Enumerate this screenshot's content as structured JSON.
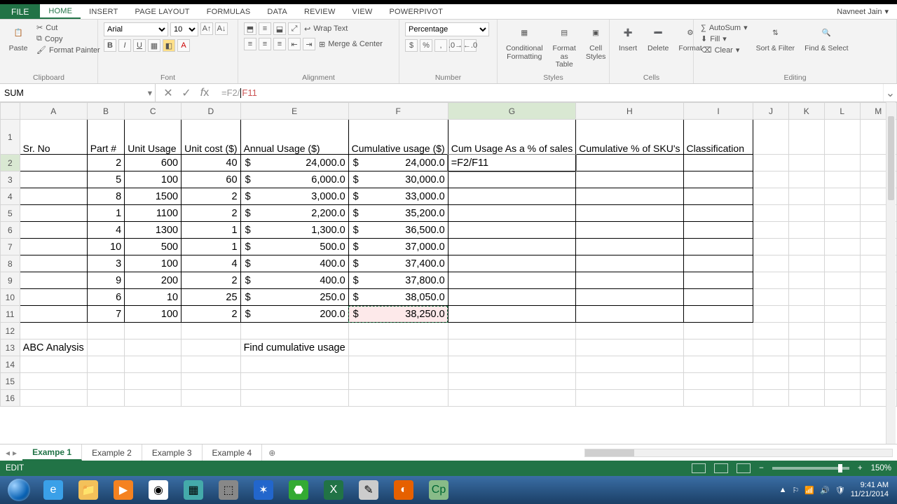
{
  "user": "Navneet Jain",
  "tabs": {
    "file": "FILE",
    "home": "HOME",
    "insert": "INSERT",
    "pageLayout": "PAGE LAYOUT",
    "formulas": "FORMULAS",
    "data": "DATA",
    "review": "REVIEW",
    "view": "VIEW",
    "powerpivot": "POWERPIVOT"
  },
  "ribbon": {
    "clipboard": {
      "paste": "Paste",
      "cut": "Cut",
      "copy": "Copy",
      "formatPainter": "Format Painter",
      "label": "Clipboard"
    },
    "font": {
      "name": "Arial",
      "size": "10",
      "label": "Font"
    },
    "alignment": {
      "wrap": "Wrap Text",
      "merge": "Merge & Center",
      "label": "Alignment"
    },
    "number": {
      "format": "Percentage",
      "label": "Number"
    },
    "styles": {
      "cond": "Conditional Formatting",
      "table": "Format as Table",
      "cell": "Cell Styles",
      "label": "Styles"
    },
    "cells": {
      "insert": "Insert",
      "delete": "Delete",
      "format": "Format",
      "label": "Cells"
    },
    "editing": {
      "autosum": "AutoSum",
      "fill": "Fill",
      "clear": "Clear",
      "sort": "Sort & Filter",
      "find": "Find & Select",
      "label": "Editing"
    }
  },
  "nameBox": "SUM",
  "formula": "=F2/F11",
  "columns": [
    "A",
    "B",
    "C",
    "D",
    "E",
    "F",
    "G",
    "H",
    "I",
    "J",
    "K",
    "L",
    "M"
  ],
  "headers": {
    "A": "Sr. No",
    "B": "Part #",
    "C": "Unit Usage",
    "D": "Unit cost ($)",
    "E": "Annual Usage ($)",
    "F": "Cumulative usage ($)",
    "G": "Cum Usage As a % of sales",
    "H": "Cumulative % of SKU's",
    "I": "Classification"
  },
  "rows": [
    {
      "B": "2",
      "C": "600",
      "D": "40",
      "E": "24,000.0",
      "F": "24,000.0",
      "G": "=F2/F11"
    },
    {
      "B": "5",
      "C": "100",
      "D": "60",
      "E": "6,000.0",
      "F": "30,000.0"
    },
    {
      "B": "8",
      "C": "1500",
      "D": "2",
      "E": "3,000.0",
      "F": "33,000.0"
    },
    {
      "B": "1",
      "C": "1100",
      "D": "2",
      "E": "2,200.0",
      "F": "35,200.0"
    },
    {
      "B": "4",
      "C": "1300",
      "D": "1",
      "E": "1,300.0",
      "F": "36,500.0"
    },
    {
      "B": "10",
      "C": "500",
      "D": "1",
      "E": "500.0",
      "F": "37,000.0"
    },
    {
      "B": "3",
      "C": "100",
      "D": "4",
      "E": "400.0",
      "F": "37,400.0"
    },
    {
      "B": "9",
      "C": "200",
      "D": "2",
      "E": "400.0",
      "F": "37,800.0"
    },
    {
      "B": "6",
      "C": "10",
      "D": "25",
      "E": "250.0",
      "F": "38,050.0"
    },
    {
      "B": "7",
      "C": "100",
      "D": "2",
      "E": "200.0",
      "F": "38,250.0"
    }
  ],
  "note": {
    "A13": "ABC Analysis",
    "E13": "Find cumulative usage"
  },
  "sheets": [
    "Exampe 1",
    "Example 2",
    "Example 3",
    "Example 4"
  ],
  "status": {
    "mode": "EDIT",
    "zoom": "150%"
  },
  "clock": {
    "time": "9:41 AM",
    "date": "11/21/2014"
  }
}
